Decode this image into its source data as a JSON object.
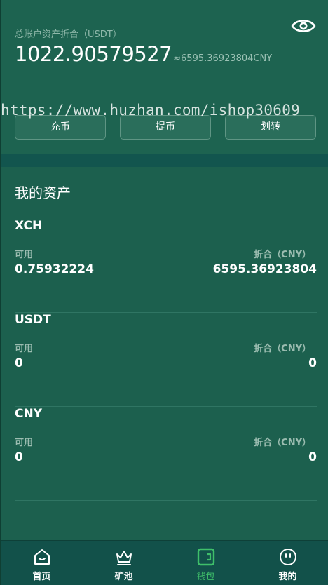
{
  "header": {
    "total_label": "总账户资产折合（USDT）",
    "total_value": "1022.90579527",
    "total_cny": "≈6595.36923804CNY",
    "watermark": "https://www.huzhan.com/ishop30609",
    "buttons": {
      "charge": "充币",
      "withdraw": "提币",
      "transfer": "划转"
    }
  },
  "assets": {
    "title": "我的资产",
    "items": [
      {
        "name": "XCH",
        "available_label": "可用",
        "available": "0.75932224",
        "converted_label": "折合（CNY）",
        "converted": "6595.36923804"
      },
      {
        "name": "USDT",
        "available_label": "可用",
        "available": "0",
        "converted_label": "折合（CNY）",
        "converted": "0"
      },
      {
        "name": "CNY",
        "available_label": "可用",
        "available": "0",
        "converted_label": "折合（CNY）",
        "converted": "0"
      }
    ]
  },
  "nav": {
    "items": [
      {
        "label": "首页",
        "icon": "home-icon"
      },
      {
        "label": "矿池",
        "icon": "crown-icon"
      },
      {
        "label": "钱包",
        "icon": "wallet-icon",
        "active": true
      },
      {
        "label": "我的",
        "icon": "profile-icon"
      }
    ]
  },
  "colors": {
    "background": "#1c604e",
    "band": "#12554e",
    "nav_background": "#12514a",
    "active": "#3fbf6a"
  }
}
